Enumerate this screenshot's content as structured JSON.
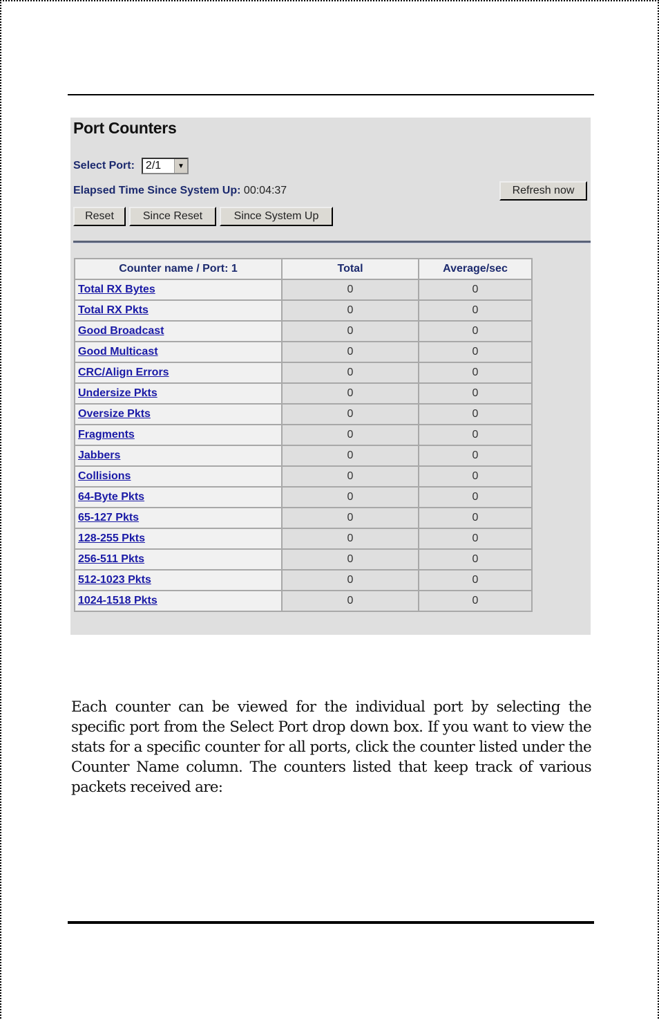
{
  "panel": {
    "title": "Port Counters",
    "select_port_label": "Select Port:",
    "select_port_value": "2/1",
    "elapsed_label": "Elapsed Time Since System Up:",
    "elapsed_value": "00:04:37",
    "buttons": {
      "refresh": "Refresh now",
      "reset": "Reset",
      "since_reset": "Since Reset",
      "since_system_up": "Since System Up"
    },
    "table": {
      "headers": [
        "Counter name / Port: 1",
        "Total",
        "Average/sec"
      ],
      "rows": [
        {
          "name": "Total RX Bytes",
          "total": "0",
          "avg": "0"
        },
        {
          "name": "Total RX Pkts",
          "total": "0",
          "avg": "0"
        },
        {
          "name": "Good Broadcast",
          "total": "0",
          "avg": "0"
        },
        {
          "name": "Good Multicast",
          "total": "0",
          "avg": "0"
        },
        {
          "name": "CRC/Align Errors",
          "total": "0",
          "avg": "0"
        },
        {
          "name": "Undersize Pkts",
          "total": "0",
          "avg": "0"
        },
        {
          "name": "Oversize Pkts",
          "total": "0",
          "avg": "0"
        },
        {
          "name": "Fragments",
          "total": "0",
          "avg": "0"
        },
        {
          "name": "Jabbers",
          "total": "0",
          "avg": "0"
        },
        {
          "name": "Collisions",
          "total": "0",
          "avg": "0"
        },
        {
          "name": "64-Byte Pkts",
          "total": "0",
          "avg": "0"
        },
        {
          "name": "65-127 Pkts",
          "total": "0",
          "avg": "0"
        },
        {
          "name": "128-255 Pkts",
          "total": "0",
          "avg": "0"
        },
        {
          "name": "256-511 Pkts",
          "total": "0",
          "avg": "0"
        },
        {
          "name": "512-1023 Pkts",
          "total": "0",
          "avg": "0"
        },
        {
          "name": "1024-1518 Pkts",
          "total": "0",
          "avg": "0"
        }
      ]
    }
  },
  "body_text": "Each counter can be viewed for the individual port by selecting the specific port from the Select Port drop down box. If you want to view the stats for a specific counter for all ports, click the counter listed under the Counter Name column.  The counters listed that keep track of various packets received are:"
}
